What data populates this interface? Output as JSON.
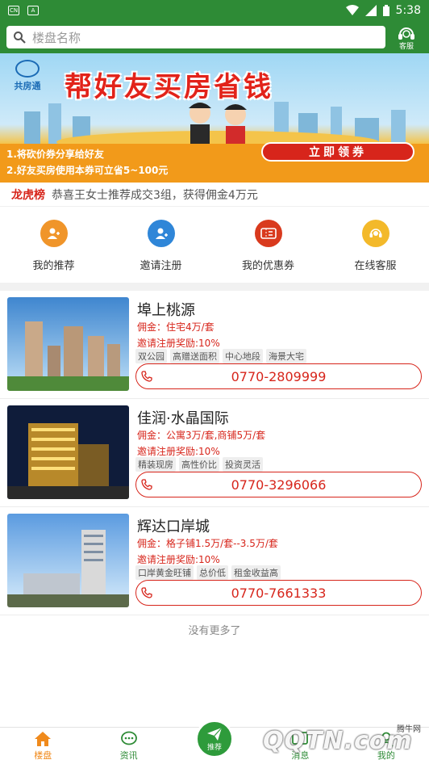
{
  "status_bar": {
    "time": "5:38",
    "left_icons": [
      "carrier-badge-icon",
      "a-badge-icon"
    ]
  },
  "header": {
    "search_placeholder": "楼盘名称",
    "service_label": "客服"
  },
  "banner": {
    "brand": "共房通",
    "title": "帮好友买房省钱",
    "line1": "1.将砍价券分享给好友",
    "line2": "2.好友买房使用本券可立省5~100元",
    "coupon_button": "立即领券"
  },
  "rank": {
    "tag": "龙虎榜",
    "message": "恭喜王女士推荐成交3组，获得佣金4万元"
  },
  "quick_menu": [
    {
      "label": "我的推荐",
      "icon": "recommend-icon",
      "color": "#f0952a"
    },
    {
      "label": "邀请注册",
      "icon": "invite-icon",
      "color": "#2f86d8"
    },
    {
      "label": "我的优惠券",
      "icon": "coupon-icon",
      "color": "#d93a1e"
    },
    {
      "label": "在线客服",
      "icon": "customer-service-icon",
      "color": "#f3b92a"
    }
  ],
  "listings": [
    {
      "name": "埠上桃源",
      "commission": "佣金：住宅4万/套",
      "reward": "邀请注册奖励:10%",
      "tags": [
        "双公园",
        "高赠送面积",
        "中心地段",
        "海景大宅"
      ],
      "phone": "0770-2809999"
    },
    {
      "name": "佳润·水晶国际",
      "commission": "佣金：公寓3万/套,商铺5万/套",
      "reward": "邀请注册奖励:10%",
      "tags": [
        "精装现房",
        "高性价比",
        "投资灵活"
      ],
      "phone": "0770-3296066"
    },
    {
      "name": "辉达口岸城",
      "commission": "佣金：格子铺1.5万/套--3.5万/套",
      "reward": "邀请注册奖励:10%",
      "tags": [
        "口岸黄金旺铺",
        "总价低",
        "租金收益高"
      ],
      "phone": "0770-7661333"
    }
  ],
  "no_more": "没有更多了",
  "tabs": [
    {
      "label": "楼盘",
      "icon": "home-icon",
      "active": true
    },
    {
      "label": "资讯",
      "icon": "chat-icon",
      "active": false
    },
    {
      "label": "推荐",
      "icon": "send-icon",
      "active": false
    },
    {
      "label": "消息",
      "icon": "message-icon",
      "active": false
    },
    {
      "label": "我的",
      "icon": "user-icon",
      "active": false
    }
  ],
  "watermark": {
    "text": "QQTN.com",
    "small": "腾牛网"
  },
  "colors": {
    "primary": "#2e8b36",
    "accent_red": "#d7251b",
    "active_tab": "#f08a1c"
  }
}
